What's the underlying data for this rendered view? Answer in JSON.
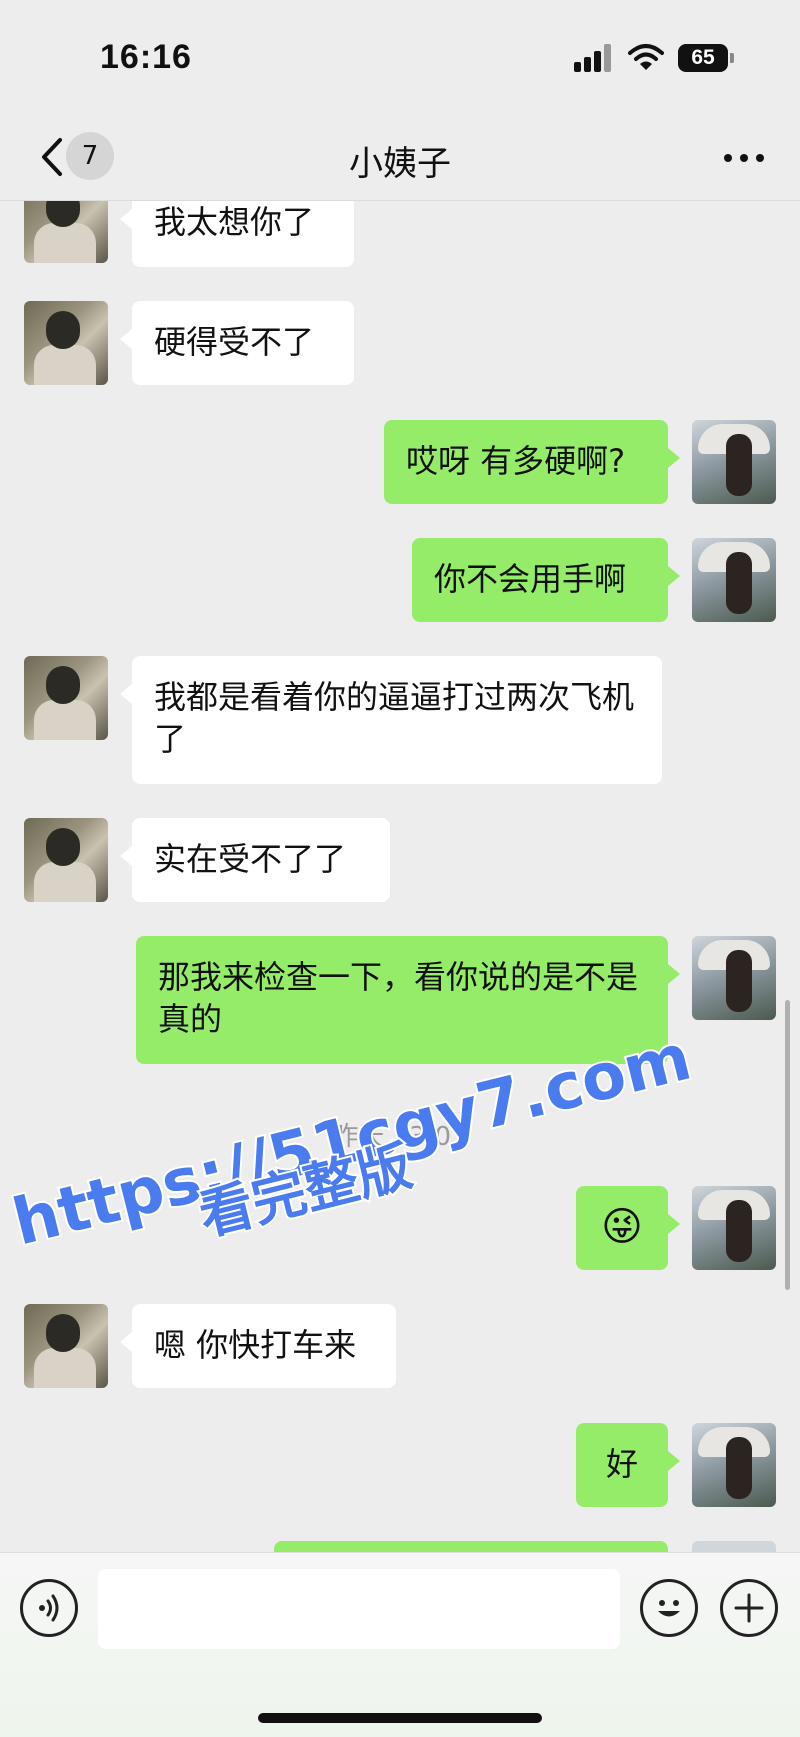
{
  "status_bar": {
    "time": "16:16",
    "battery": "65"
  },
  "nav": {
    "back_badge": "7",
    "title": "小姨子"
  },
  "messages": [
    {
      "side": "in",
      "text": "我太想你了"
    },
    {
      "side": "in",
      "text": "硬得受不了"
    },
    {
      "side": "out",
      "text": "哎呀 有多硬啊?"
    },
    {
      "side": "out",
      "text": "你不会用手啊"
    },
    {
      "side": "in",
      "text": "我都是看着你的逼逼打过两次飞机了"
    },
    {
      "side": "in",
      "text": "实在受不了了"
    },
    {
      "side": "out",
      "text": "那我来检查一下，看你说的是不是真的"
    },
    {
      "side": "out",
      "text": "😜"
    },
    {
      "side": "in",
      "text": "嗯 你快打车来"
    },
    {
      "side": "out",
      "text": "好"
    }
  ],
  "timestamp": "昨天 23:01",
  "watermark": {
    "line1": "https://51cgy7.com",
    "line2": "看完整版"
  },
  "icons": {
    "back": "chevron-left-icon",
    "more": "more-dots-icon",
    "voice": "voice-input-icon",
    "emoji": "emoji-icon",
    "plus": "plus-icon"
  },
  "colors": {
    "outgoing_bubble": "#95ec69",
    "incoming_bubble": "#ffffff",
    "watermark": "#4a7cf0"
  },
  "input": {
    "value": "",
    "placeholder": ""
  }
}
